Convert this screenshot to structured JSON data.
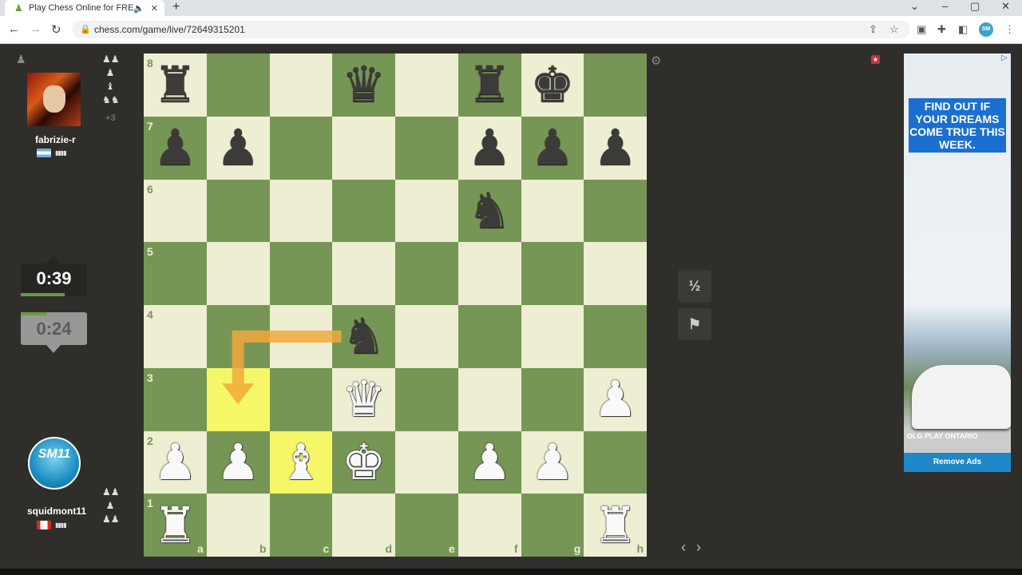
{
  "browser": {
    "tab_title": "Play Chess Online for FREE w",
    "url": "chess.com/game/live/72649315201",
    "new_tab": "+",
    "tab_close": "✕",
    "tab_audio": "🔈",
    "profile_initials": "SM"
  },
  "top_player": {
    "name": "fabrizie-r",
    "clock": "0:39",
    "clock_progress": 0.66,
    "captures": [
      "♟♟",
      "♟",
      "♝",
      "♞♞"
    ],
    "advantage": "+3"
  },
  "bottom_player": {
    "name": "squidmont11",
    "clock": "0:24",
    "clock_progress": 0.4,
    "avatar_text": "SM11",
    "captures": [
      "♟♟",
      "♟",
      "♟♟"
    ]
  },
  "board": {
    "ranks": [
      "8",
      "7",
      "6",
      "5",
      "4",
      "3",
      "2",
      "1"
    ],
    "files": [
      "a",
      "b",
      "c",
      "d",
      "e",
      "f",
      "g",
      "h"
    ],
    "pieces": [
      {
        "sq": "a8",
        "p": "♜",
        "c": "b"
      },
      {
        "sq": "d8",
        "p": "♛",
        "c": "b"
      },
      {
        "sq": "f8",
        "p": "♜",
        "c": "b"
      },
      {
        "sq": "g8",
        "p": "♚",
        "c": "b"
      },
      {
        "sq": "a7",
        "p": "♟",
        "c": "b"
      },
      {
        "sq": "b7",
        "p": "♟",
        "c": "b"
      },
      {
        "sq": "f7",
        "p": "♟",
        "c": "b"
      },
      {
        "sq": "g7",
        "p": "♟",
        "c": "b"
      },
      {
        "sq": "h7",
        "p": "♟",
        "c": "b"
      },
      {
        "sq": "f6",
        "p": "♞",
        "c": "b"
      },
      {
        "sq": "d4",
        "p": "♞",
        "c": "b"
      },
      {
        "sq": "d3",
        "p": "♛",
        "c": "w"
      },
      {
        "sq": "h3",
        "p": "♟",
        "c": "w"
      },
      {
        "sq": "a2",
        "p": "♟",
        "c": "w"
      },
      {
        "sq": "b2",
        "p": "♟",
        "c": "w"
      },
      {
        "sq": "c2",
        "p": "♝",
        "c": "w"
      },
      {
        "sq": "d2",
        "p": "♚",
        "c": "w"
      },
      {
        "sq": "f2",
        "p": "♟",
        "c": "w"
      },
      {
        "sq": "g2",
        "p": "♟",
        "c": "w"
      },
      {
        "sq": "a1",
        "p": "♜",
        "c": "w"
      },
      {
        "sq": "h1",
        "p": "♜",
        "c": "w"
      }
    ],
    "highlights": [
      "b3",
      "c2"
    ],
    "arrow": {
      "from": "d4",
      "to": "b3",
      "color": "#f2a93b"
    }
  },
  "controls": {
    "draw": "½",
    "resign": "⚑",
    "settings": "⚙",
    "prev_next": "‹ ›"
  },
  "ad": {
    "headline": "FIND OUT IF YOUR DREAMS COME TRUE THIS WEEK.",
    "brand": "OLG PLAY ONTARIO",
    "remove": "Remove Ads",
    "info": "▷"
  }
}
